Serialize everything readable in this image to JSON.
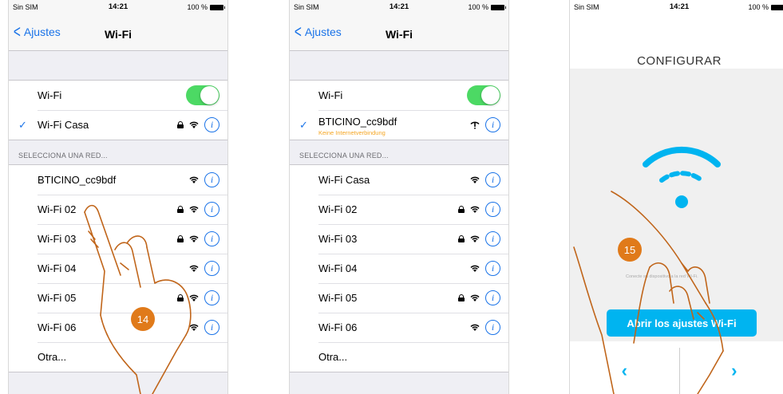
{
  "status": {
    "carrier": "Sin SIM",
    "time": "14:21",
    "battery": "100 %"
  },
  "screen1": {
    "back": "Ajustes",
    "title": "Wi-Fi",
    "wifi_label": "Wi-Fi",
    "connected": "Wi-Fi Casa",
    "section": "SELECCIONA UNA RED...",
    "networks": [
      {
        "name": "BTICINO_cc9bdf",
        "lock": false
      },
      {
        "name": "Wi-Fi 02",
        "lock": true
      },
      {
        "name": "Wi-Fi 03",
        "lock": true
      },
      {
        "name": "Wi-Fi 04",
        "lock": false
      },
      {
        "name": "Wi-Fi 05",
        "lock": true
      },
      {
        "name": "Wi-Fi 06",
        "lock": false
      },
      {
        "name": "Otra...",
        "lock": false
      }
    ],
    "step": "14"
  },
  "screen2": {
    "back": "Ajustes",
    "title": "Wi-Fi",
    "wifi_label": "Wi-Fi",
    "connected": "BTICINO_cc9bdf",
    "warning": "Keine Internetverbindung",
    "section": "SELECCIONA UNA RED...",
    "networks": [
      {
        "name": "Wi-Fi Casa",
        "lock": false
      },
      {
        "name": "Wi-Fi 02",
        "lock": true
      },
      {
        "name": "Wi-Fi 03",
        "lock": true
      },
      {
        "name": "Wi-Fi 04",
        "lock": false
      },
      {
        "name": "Wi-Fi 05",
        "lock": true
      },
      {
        "name": "Wi-Fi 06",
        "lock": false
      },
      {
        "name": "Otra...",
        "lock": false
      }
    ]
  },
  "screen3": {
    "title": "CONFIGURAR",
    "hint": "Conecte su dispositivo a la red Wi-Fi.",
    "button": "Abrir los ajustes Wi-Fi",
    "prev": "‹",
    "next": "›",
    "step": "15"
  },
  "colors": {
    "accent": "#1a73e8",
    "toggle": "#4cd964",
    "brand": "#00b4f0",
    "badge": "#e07a1a",
    "warning": "#f5a623"
  }
}
